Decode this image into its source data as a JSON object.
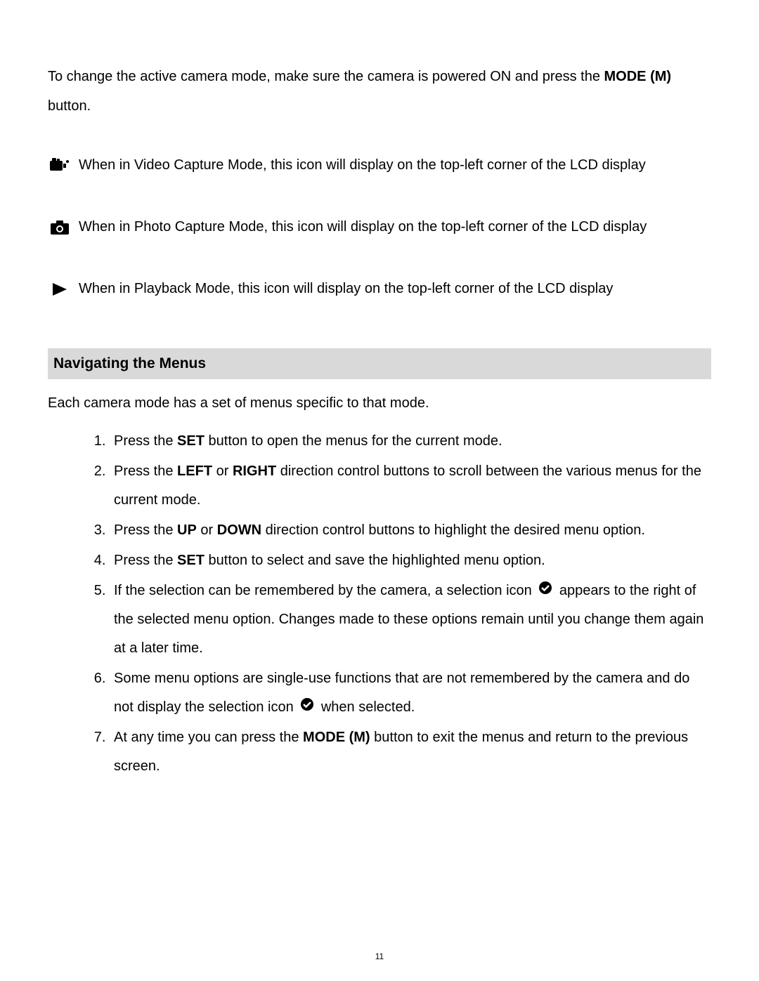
{
  "intro": {
    "prefix": "To change the active camera mode, make sure the camera is powered ON and press the ",
    "bold1": "MODE (M)",
    "suffix": " button."
  },
  "modes": {
    "video": "When in Video Capture Mode, this icon will display on the top-left corner of the LCD display",
    "photo": "When in Photo Capture Mode, this icon will display on the top-left corner of the LCD display",
    "playback": "When in Playback Mode, this icon will display on the top-left corner of the LCD display"
  },
  "section": {
    "header": "Navigating the Menus",
    "intro": "Each camera mode has a set of menus specific to that mode."
  },
  "steps": {
    "s1a": "Press the ",
    "s1b": "SET",
    "s1c": " button to open the menus for the current mode.",
    "s2a": "Press the ",
    "s2b": "LEFT",
    "s2c": " or ",
    "s2d": "RIGHT",
    "s2e": " direction control buttons to scroll between the various menus for the current mode.",
    "s3a": "Press the ",
    "s3b": "UP",
    "s3c": " or ",
    "s3d": "DOWN",
    "s3e": " direction control buttons to highlight the desired menu option.",
    "s4a": "Press the ",
    "s4b": "SET",
    "s4c": " button to select and save the highlighted menu option.",
    "s5a": "If the selection can be remembered by the camera, a selection icon ",
    "s5b": " appears to the right of the selected menu option. Changes made to these options remain until you change them again at a later time.",
    "s6a": "Some menu options are single-use functions that are not remembered by the camera and do not display the selection icon ",
    "s6b": " when selected.",
    "s7a": "At any time you can press the ",
    "s7b": "MODE (M)",
    "s7c": " button to exit the menus and return to the previous screen."
  },
  "pageNumber": "11"
}
